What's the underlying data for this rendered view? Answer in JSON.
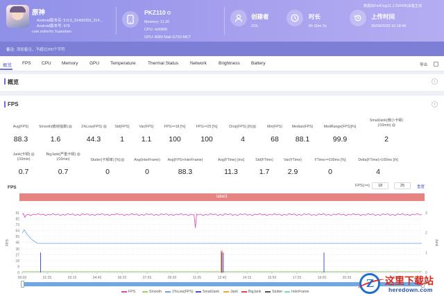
{
  "header": {
    "app_name": "原神",
    "app_version_line": "Android版本名: 5.5.0_31400259_314...",
    "android_version_line": "Android版本号: 979",
    "package": "com.miHoYo.Yuanshen",
    "device_name": "PKZ110",
    "memory": "Memory: 11.20",
    "cpu": "CPU: mt6899",
    "gpu": "GPU: ARM Mali-G720 MC7",
    "creator_label": "创建者",
    "creator_value": "ZOL",
    "duration_label": "时长",
    "duration_value": "0h 30m 2s",
    "upload_label": "上传时间",
    "upload_value": "30/04/2025 16:18:46",
    "version_note": "数据由PerfDog(11.2.250408)采集生成"
  },
  "notes": {
    "label": "备注:",
    "placeholder": "添加备注，不超过200个字符"
  },
  "tabs": [
    "概览",
    "FPS",
    "CPU",
    "Memory",
    "GPU",
    "Temperature",
    "Thermal Status",
    "Network",
    "Brightness",
    "Battery"
  ],
  "export_label": "导出",
  "overview_title": "概览",
  "fps_title": "FPS",
  "metrics_row1": [
    {
      "label": "Avg(FPS)",
      "value": "88.3",
      "help": false
    },
    {
      "label": "Smooth(稳帧指数)",
      "value": "1.6",
      "help": true
    },
    {
      "label": "1%Low(FPS)",
      "value": "44.3",
      "help": true
    },
    {
      "label": "Std(FPS)",
      "value": "1",
      "help": false
    },
    {
      "label": "Var(FPS)",
      "value": "1.1",
      "help": false
    },
    {
      "label": "FPS>=18 [%]",
      "value": "100",
      "help": false
    },
    {
      "label": "FPS>=25 [%]",
      "value": "100",
      "help": false
    },
    {
      "label": "Drop(FPS) [/h]",
      "value": "4",
      "help": true
    },
    {
      "label": "Min(FPS)",
      "value": "68",
      "help": false
    },
    {
      "label": "Median(FPS)",
      "value": "88.1",
      "help": false
    },
    {
      "label": "MedRange(FPS)[%]",
      "value": "99.9",
      "help": false
    },
    {
      "label1": "SmallJank(微小卡顿)",
      "label2": "(/10min)",
      "value": "2",
      "help": true
    }
  ],
  "metrics_row2": [
    {
      "label1": "Jank(卡顿)",
      "label2": "(/10min)",
      "value": "0.7",
      "help": true
    },
    {
      "label1": "BigJank(严重卡顿)",
      "label2": "(/10min)",
      "value": "0.7",
      "help": true
    },
    {
      "label": "Stutter(卡顿率) [%]",
      "value": "0",
      "help": true
    },
    {
      "label": "Avg(InterFrame)",
      "value": "0",
      "help": false
    },
    {
      "label": "Avg(FPS+InterFrame)",
      "value": "88.3",
      "help": false
    },
    {
      "label": "Avg(FTime) [ms]",
      "value": "11.3",
      "help": false
    },
    {
      "label": "Std(FTime)",
      "value": "1.7",
      "help": false
    },
    {
      "label": "Var(FTime)",
      "value": "2.9",
      "help": false
    },
    {
      "label": "FTime>=100ms [%]",
      "value": "0",
      "help": false
    },
    {
      "label": "Delta(FTime)>100ms [/h]",
      "value": "4",
      "help": false
    }
  ],
  "chart_controls": {
    "fps_label": "FPS(>=)",
    "threshold_1": "18",
    "threshold_2": "25",
    "reset_label": "重置"
  },
  "chart_data": {
    "type": "line",
    "title": "FPS",
    "label_band": "label1",
    "ylabel_left": "FPS",
    "ylabel_right": "Jank",
    "y_ticks_left": [
      91,
      82,
      73,
      64,
      55,
      46,
      36,
      27,
      18,
      9,
      0
    ],
    "y_ticks_right": [
      3,
      2,
      1,
      0
    ],
    "x_ticks": [
      "00:00",
      "01:35",
      "03:10",
      "04:45",
      "06:20",
      "07:55",
      "09:30",
      "11:05",
      "12:40",
      "14:15",
      "15:50",
      "17:25",
      "19:00",
      "20:35",
      "22:10",
      "23:45"
    ],
    "series": [
      {
        "name": "FPS",
        "color": "#d548b4",
        "level": 88.3,
        "min": 68,
        "max": 91
      },
      {
        "name": "Smooth",
        "color": "#9cd46b",
        "level": 1.6
      },
      {
        "name": "1%Low(FPS)",
        "color": "#6fa0e6",
        "level": 44.3
      },
      {
        "name": "SmallJank",
        "color": "#3b54c9",
        "events": [
          "01:10",
          "12:38",
          "12:45",
          "19:08"
        ]
      },
      {
        "name": "Jank",
        "color": "#f0a23c",
        "events": [
          "12:38"
        ]
      },
      {
        "name": "BigJank",
        "color": "#e34545",
        "events": [
          "12:38"
        ]
      },
      {
        "name": "Stutter",
        "color": "#4c4f66"
      },
      {
        "name": "InterFrame",
        "color": "#73d9c4"
      }
    ]
  },
  "watermark": {
    "logo_letter": "Z",
    "cn": "这里下载站",
    "en": "heredown.com"
  }
}
